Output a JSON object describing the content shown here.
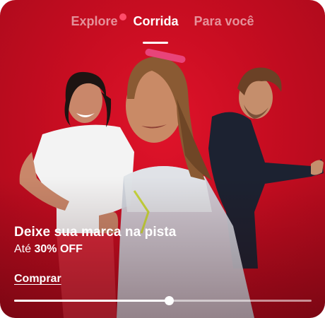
{
  "tabs": [
    {
      "label": "Explore",
      "has_notification": true
    },
    {
      "label": "Corrida",
      "active": true
    },
    {
      "label": "Para você"
    }
  ],
  "banner": {
    "headline": "Deixe sua marca na pista",
    "offer_prefix": "Até",
    "offer_value": "30% OFF",
    "cta_label": "Comprar",
    "background_color": "#c70d21",
    "carousel_progress": 0.52
  }
}
